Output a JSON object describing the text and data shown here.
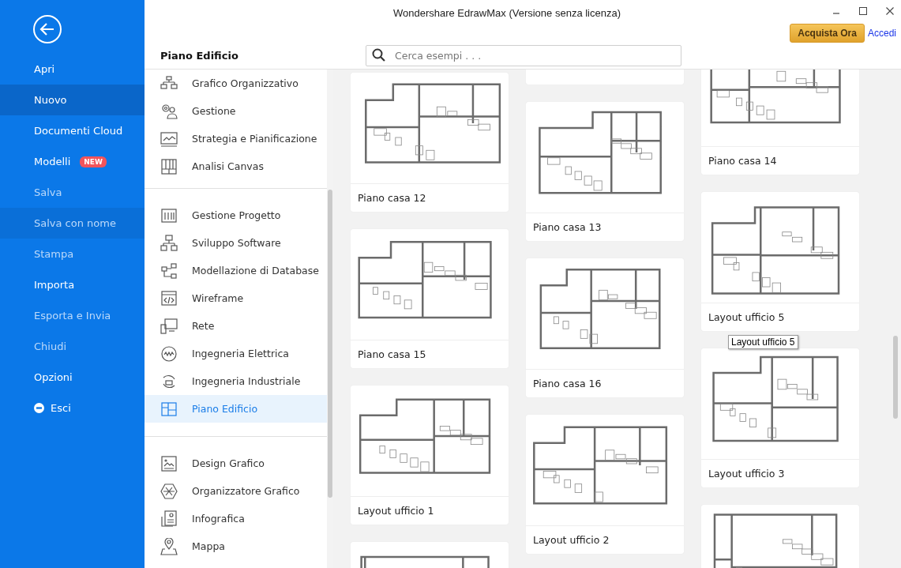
{
  "window": {
    "title": "Wondershare EdrawMax (Versione senza licenza)"
  },
  "nav": {
    "items": [
      {
        "label": "Apri",
        "kind": "plain",
        "selected": false,
        "disabled": false,
        "hovered": false
      },
      {
        "label": "Nuovo",
        "kind": "plain",
        "selected": true,
        "disabled": false,
        "hovered": false
      },
      {
        "label": "Documenti Cloud",
        "kind": "plain",
        "selected": false,
        "disabled": false,
        "hovered": false
      },
      {
        "label": "Modelli",
        "kind": "plain",
        "badge": "NEW",
        "selected": false,
        "disabled": false,
        "hovered": false
      },
      {
        "label": "Salva",
        "kind": "plain",
        "selected": false,
        "disabled": true,
        "hovered": false
      },
      {
        "label": "Salva con nome",
        "kind": "plain",
        "selected": false,
        "disabled": true,
        "hovered": true
      },
      {
        "label": "Stampa",
        "kind": "plain",
        "selected": false,
        "disabled": true,
        "hovered": false
      },
      {
        "label": "Importa",
        "kind": "plain",
        "selected": false,
        "disabled": false,
        "hovered": false
      },
      {
        "label": "Esporta e Invia",
        "kind": "plain",
        "selected": false,
        "disabled": true,
        "hovered": false
      },
      {
        "label": "Chiudi",
        "kind": "plain",
        "selected": false,
        "disabled": true,
        "hovered": false
      },
      {
        "label": "Opzioni",
        "kind": "plain",
        "selected": false,
        "disabled": false,
        "hovered": false
      },
      {
        "label": "Esci",
        "kind": "exit",
        "selected": false,
        "disabled": false,
        "hovered": false
      }
    ]
  },
  "header": {
    "title": "Piano Edificio",
    "buy_button": "Acquista Ora",
    "login_link": "Accedi"
  },
  "search": {
    "placeholder": "Cerca esempi . . ."
  },
  "categories": {
    "groups": [
      [
        {
          "label": "Grafico Organizzativo",
          "selected": false
        },
        {
          "label": "Gestione",
          "selected": false
        },
        {
          "label": "Strategia e Pianificazione",
          "selected": false
        },
        {
          "label": "Analisi Canvas",
          "selected": false
        }
      ],
      [
        {
          "label": "Gestione Progetto",
          "selected": false
        },
        {
          "label": "Sviluppo Software",
          "selected": false
        },
        {
          "label": "Modellazione di Database",
          "selected": false
        },
        {
          "label": "Wireframe",
          "selected": false
        },
        {
          "label": "Rete",
          "selected": false
        },
        {
          "label": "Ingegneria Elettrica",
          "selected": false
        },
        {
          "label": "Ingegneria Industriale",
          "selected": false
        },
        {
          "label": "Piano Edificio",
          "selected": true
        }
      ],
      [
        {
          "label": "Design Grafico",
          "selected": false
        },
        {
          "label": "Organizzatore Grafico",
          "selected": false
        },
        {
          "label": "Infografica",
          "selected": false
        },
        {
          "label": "Mappa",
          "selected": false
        }
      ]
    ]
  },
  "gallery": {
    "columns": [
      [
        {
          "title": "Piano casa 12"
        },
        {
          "title": "Piano casa 15"
        },
        {
          "title": "Layout ufficio 1"
        },
        {}
      ],
      [
        {},
        {
          "title": "Piano casa 13"
        },
        {
          "title": "Piano casa 16"
        },
        {
          "title": "Layout ufficio 2"
        }
      ],
      [
        {
          "title": "Piano casa 14"
        },
        {
          "title": "Layout ufficio 5"
        },
        {
          "title": "Layout ufficio 3"
        },
        {}
      ]
    ],
    "tooltip": "Layout ufficio 5"
  }
}
